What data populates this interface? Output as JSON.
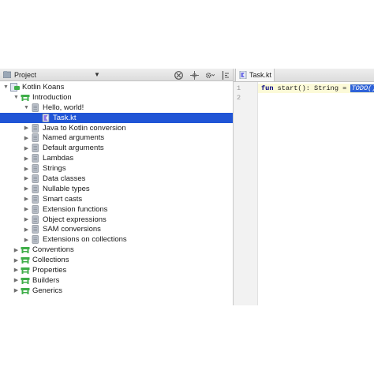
{
  "project_panel": {
    "title": "Project",
    "tree": [
      {
        "label": "Kotlin Koans",
        "level": 0,
        "arrow": "down",
        "icon": "module-icon"
      },
      {
        "label": "Introduction",
        "level": 1,
        "arrow": "down",
        "icon": "package-icon"
      },
      {
        "label": "Hello, world!",
        "level": 2,
        "arrow": "down",
        "icon": "file-icon"
      },
      {
        "label": "Task.kt",
        "level": 3,
        "arrow": "",
        "icon": "kotlin-file-icon",
        "selected": true
      },
      {
        "label": "Java to Kotlin conversion",
        "level": 2,
        "arrow": "right",
        "icon": "file-icon"
      },
      {
        "label": "Named arguments",
        "level": 2,
        "arrow": "right",
        "icon": "file-icon"
      },
      {
        "label": "Default arguments",
        "level": 2,
        "arrow": "right",
        "icon": "file-icon"
      },
      {
        "label": "Lambdas",
        "level": 2,
        "arrow": "right",
        "icon": "file-icon"
      },
      {
        "label": "Strings",
        "level": 2,
        "arrow": "right",
        "icon": "file-icon"
      },
      {
        "label": "Data classes",
        "level": 2,
        "arrow": "right",
        "icon": "file-icon"
      },
      {
        "label": "Nullable types",
        "level": 2,
        "arrow": "right",
        "icon": "file-icon"
      },
      {
        "label": "Smart casts",
        "level": 2,
        "arrow": "right",
        "icon": "file-icon"
      },
      {
        "label": "Extension functions",
        "level": 2,
        "arrow": "right",
        "icon": "file-icon"
      },
      {
        "label": "Object expressions",
        "level": 2,
        "arrow": "right",
        "icon": "file-icon"
      },
      {
        "label": "SAM conversions",
        "level": 2,
        "arrow": "right",
        "icon": "file-icon"
      },
      {
        "label": "Extensions on collections",
        "level": 2,
        "arrow": "right",
        "icon": "file-icon"
      },
      {
        "label": "Conventions",
        "level": 1,
        "arrow": "right",
        "icon": "package-icon"
      },
      {
        "label": "Collections",
        "level": 1,
        "arrow": "right",
        "icon": "package-icon"
      },
      {
        "label": "Properties",
        "level": 1,
        "arrow": "right",
        "icon": "package-icon"
      },
      {
        "label": "Builders",
        "level": 1,
        "arrow": "right",
        "icon": "package-icon"
      },
      {
        "label": "Generics",
        "level": 1,
        "arrow": "right",
        "icon": "package-icon"
      }
    ]
  },
  "editor": {
    "tab_label": "Task.kt",
    "line_numbers": [
      "1",
      "2"
    ],
    "code": {
      "keyword": "fun",
      "signature": " start(): String = ",
      "todo": "TODO()"
    }
  },
  "colors": {
    "selection": "#2055d6",
    "package_green": "#3fae49",
    "keyword": "#000080"
  }
}
